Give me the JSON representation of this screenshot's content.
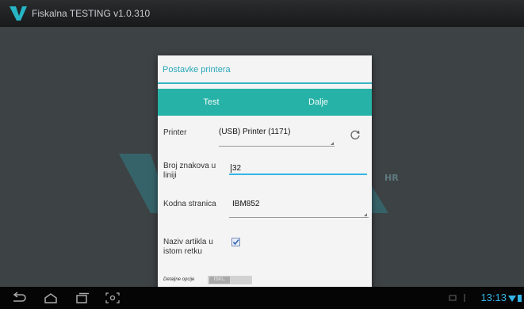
{
  "app": {
    "title": "Fiskalna TESTING v1.0.310"
  },
  "background": {
    "suffix": "HR"
  },
  "dialog": {
    "title": "Postavke printera",
    "buttons": {
      "test": "Test",
      "next": "Dalje"
    },
    "printer": {
      "label": "Printer",
      "value": "(USB) Printer (1171)"
    },
    "chars_per_line": {
      "label_line1": "Broj znakova u",
      "label_line2": "liniji",
      "value": "32"
    },
    "code_page": {
      "label": "Kodna stranica",
      "value": "IBM852"
    },
    "item_name": {
      "label_line1": "Naziv artikla u",
      "label_line2": "istom retku",
      "checked": true
    },
    "details": {
      "label": "Detaljne opcije",
      "toggle_state": "ISKL."
    }
  },
  "statusbar": {
    "clock": "13:13"
  },
  "colors": {
    "accent": "#26b2a6",
    "title": "#2aa8b9",
    "clock": "#33b5e5"
  }
}
